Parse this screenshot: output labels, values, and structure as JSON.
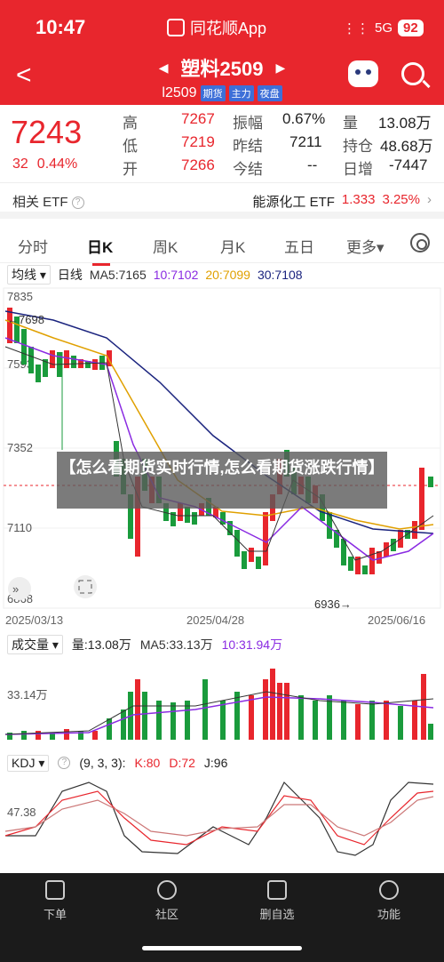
{
  "status": {
    "time": "10:47",
    "app": "同花顺App",
    "network": "5G",
    "battery": "92"
  },
  "nav": {
    "title": "塑料2509",
    "code": "l2509",
    "tags": [
      "期货",
      "主力",
      "夜盘"
    ]
  },
  "quote": {
    "price": "7243",
    "change": "32",
    "change_pct": "0.44%",
    "cells": [
      {
        "label": "高",
        "value": "7267",
        "color": "red"
      },
      {
        "label": "低",
        "value": "7219",
        "color": "red"
      },
      {
        "label": "开",
        "value": "7266",
        "color": "red"
      },
      {
        "label": "振幅",
        "value": "0.67%",
        "color": "black"
      },
      {
        "label": "昨结",
        "value": "7211",
        "color": "black"
      },
      {
        "label": "今结",
        "value": "--",
        "color": "black"
      },
      {
        "label": "量",
        "value": "13.08万",
        "color": "black"
      },
      {
        "label": "持仓",
        "value": "48.68万",
        "color": "black"
      },
      {
        "label": "日增",
        "value": "-7447",
        "color": "black"
      }
    ]
  },
  "etf": {
    "label": "相关 ETF",
    "name": "能源化工 ETF",
    "price": "1.333",
    "pct": "3.25%"
  },
  "tabs": [
    "分时",
    "日K",
    "周K",
    "月K",
    "五日",
    "更多"
  ],
  "ma": {
    "type": "均线",
    "period": "日线",
    "ma5": "MA5:7165",
    "ma10": "10:7102",
    "ma20": "20:7099",
    "ma30": "30:7108"
  },
  "kchart": {
    "axis": [
      "7835",
      "7593",
      "7352",
      "7110",
      "6868"
    ],
    "high_label": "←7698",
    "low_label": "6936→",
    "dates": [
      "2025/03/13",
      "2025/04/28",
      "2025/06/16"
    ]
  },
  "overlay": "【怎么看期货实时行情,怎么看期货涨跌行情】",
  "volume": {
    "label": "成交量",
    "vol": "量:13.08万",
    "ma5": "MA5:33.13万",
    "ma10": "10:31.94万",
    "axis": "33.14万"
  },
  "kdj": {
    "label": "KDJ",
    "params": "(9, 3, 3):",
    "k": "K:80",
    "d": "D:72",
    "j": "J:96",
    "axis": "47.38"
  },
  "bottom_nav": [
    "下单",
    "社区",
    "删自选",
    "功能"
  ],
  "colors": {
    "up": "#e8262d",
    "down": "#1a9b3c",
    "ma5": "#333333",
    "ma10": "#8a2be2",
    "ma20": "#e0a000",
    "ma30": "#1a237e"
  }
}
